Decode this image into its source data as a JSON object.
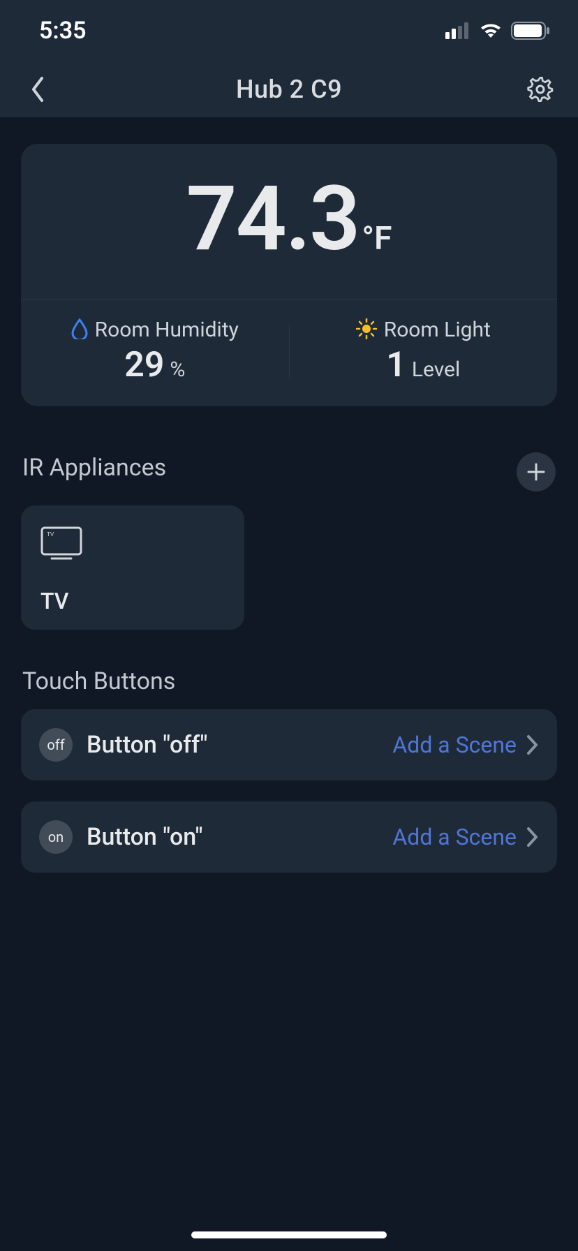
{
  "status": {
    "time": "5:35"
  },
  "header": {
    "title": "Hub 2 C9"
  },
  "sensor": {
    "temp_value": "74.3",
    "temp_unit": "°F",
    "humidity_label": "Room Humidity",
    "humidity_value": "29",
    "humidity_unit": "%",
    "light_label": "Room Light",
    "light_value": "1",
    "light_unit": "Level"
  },
  "sections": {
    "ir_title": "IR Appliances",
    "touch_title": "Touch Buttons"
  },
  "appliances": [
    {
      "label": "TV",
      "icon": "tv-icon"
    }
  ],
  "touch_buttons": [
    {
      "badge": "off",
      "label": "Button \"off\"",
      "action": "Add a Scene"
    },
    {
      "badge": "on",
      "label": "Button \"on\"",
      "action": "Add a Scene"
    }
  ]
}
